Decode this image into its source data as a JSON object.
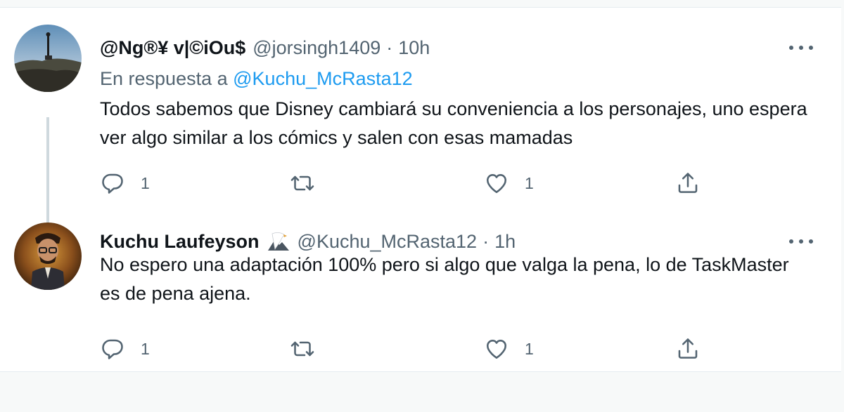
{
  "tweets": [
    {
      "display_name": "@Ng®¥ v|©iOu$",
      "handle": "@jorsingh1409",
      "separator": "·",
      "time": "10h",
      "reply_prefix": "En respuesta a",
      "reply_to": "@Kuchu_McRasta12",
      "text": "Todos sabemos que Disney cambiará su conveniencia a los personajes, uno espera ver algo similar a los cómics y salen con esas mamadas",
      "reply_count": "1",
      "like_count": "1"
    },
    {
      "display_name": "Kuchu Laufeyson",
      "handle": "@Kuchu_McRasta12",
      "separator": "·",
      "time": "1h",
      "text": "No espero una adaptación 100% pero si algo que valga la pena, lo de TaskMaster es de pena ajena.",
      "reply_count": "1",
      "like_count": "1"
    }
  ],
  "icons": {
    "more": "more-horizontal-icon",
    "reply": "reply-bubble-icon",
    "retweet": "retweet-icon",
    "like": "heart-icon",
    "share": "share-upload-icon",
    "badge": "eagle-emoji-icon"
  },
  "colors": {
    "link": "#1d9bf0",
    "secondary_text": "#536471",
    "thread_line": "#cfd9de"
  }
}
